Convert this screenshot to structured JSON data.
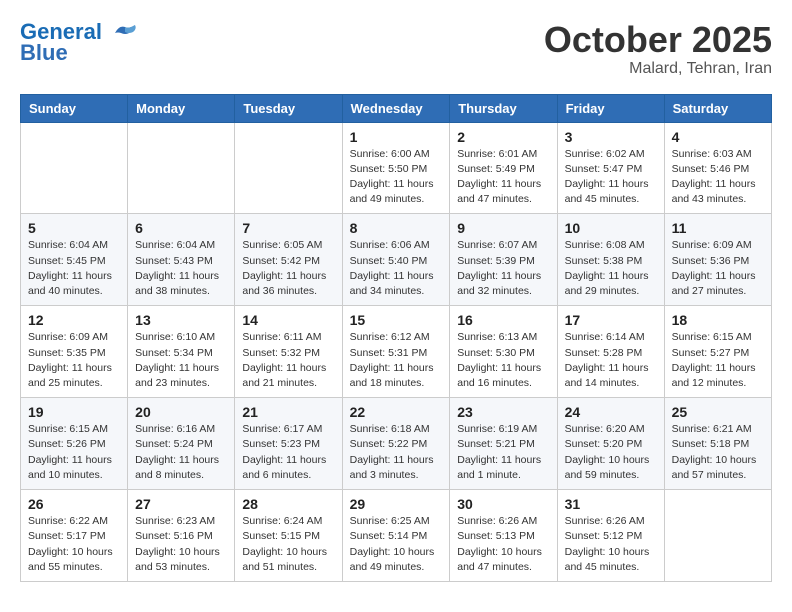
{
  "header": {
    "logo_general": "General",
    "logo_blue": "Blue",
    "month": "October 2025",
    "location": "Malard, Tehran, Iran"
  },
  "weekdays": [
    "Sunday",
    "Monday",
    "Tuesday",
    "Wednesday",
    "Thursday",
    "Friday",
    "Saturday"
  ],
  "weeks": [
    [
      {
        "day": "",
        "info": ""
      },
      {
        "day": "",
        "info": ""
      },
      {
        "day": "",
        "info": ""
      },
      {
        "day": "1",
        "info": "Sunrise: 6:00 AM\nSunset: 5:50 PM\nDaylight: 11 hours\nand 49 minutes."
      },
      {
        "day": "2",
        "info": "Sunrise: 6:01 AM\nSunset: 5:49 PM\nDaylight: 11 hours\nand 47 minutes."
      },
      {
        "day": "3",
        "info": "Sunrise: 6:02 AM\nSunset: 5:47 PM\nDaylight: 11 hours\nand 45 minutes."
      },
      {
        "day": "4",
        "info": "Sunrise: 6:03 AM\nSunset: 5:46 PM\nDaylight: 11 hours\nand 43 minutes."
      }
    ],
    [
      {
        "day": "5",
        "info": "Sunrise: 6:04 AM\nSunset: 5:45 PM\nDaylight: 11 hours\nand 40 minutes."
      },
      {
        "day": "6",
        "info": "Sunrise: 6:04 AM\nSunset: 5:43 PM\nDaylight: 11 hours\nand 38 minutes."
      },
      {
        "day": "7",
        "info": "Sunrise: 6:05 AM\nSunset: 5:42 PM\nDaylight: 11 hours\nand 36 minutes."
      },
      {
        "day": "8",
        "info": "Sunrise: 6:06 AM\nSunset: 5:40 PM\nDaylight: 11 hours\nand 34 minutes."
      },
      {
        "day": "9",
        "info": "Sunrise: 6:07 AM\nSunset: 5:39 PM\nDaylight: 11 hours\nand 32 minutes."
      },
      {
        "day": "10",
        "info": "Sunrise: 6:08 AM\nSunset: 5:38 PM\nDaylight: 11 hours\nand 29 minutes."
      },
      {
        "day": "11",
        "info": "Sunrise: 6:09 AM\nSunset: 5:36 PM\nDaylight: 11 hours\nand 27 minutes."
      }
    ],
    [
      {
        "day": "12",
        "info": "Sunrise: 6:09 AM\nSunset: 5:35 PM\nDaylight: 11 hours\nand 25 minutes."
      },
      {
        "day": "13",
        "info": "Sunrise: 6:10 AM\nSunset: 5:34 PM\nDaylight: 11 hours\nand 23 minutes."
      },
      {
        "day": "14",
        "info": "Sunrise: 6:11 AM\nSunset: 5:32 PM\nDaylight: 11 hours\nand 21 minutes."
      },
      {
        "day": "15",
        "info": "Sunrise: 6:12 AM\nSunset: 5:31 PM\nDaylight: 11 hours\nand 18 minutes."
      },
      {
        "day": "16",
        "info": "Sunrise: 6:13 AM\nSunset: 5:30 PM\nDaylight: 11 hours\nand 16 minutes."
      },
      {
        "day": "17",
        "info": "Sunrise: 6:14 AM\nSunset: 5:28 PM\nDaylight: 11 hours\nand 14 minutes."
      },
      {
        "day": "18",
        "info": "Sunrise: 6:15 AM\nSunset: 5:27 PM\nDaylight: 11 hours\nand 12 minutes."
      }
    ],
    [
      {
        "day": "19",
        "info": "Sunrise: 6:15 AM\nSunset: 5:26 PM\nDaylight: 11 hours\nand 10 minutes."
      },
      {
        "day": "20",
        "info": "Sunrise: 6:16 AM\nSunset: 5:24 PM\nDaylight: 11 hours\nand 8 minutes."
      },
      {
        "day": "21",
        "info": "Sunrise: 6:17 AM\nSunset: 5:23 PM\nDaylight: 11 hours\nand 6 minutes."
      },
      {
        "day": "22",
        "info": "Sunrise: 6:18 AM\nSunset: 5:22 PM\nDaylight: 11 hours\nand 3 minutes."
      },
      {
        "day": "23",
        "info": "Sunrise: 6:19 AM\nSunset: 5:21 PM\nDaylight: 11 hours\nand 1 minute."
      },
      {
        "day": "24",
        "info": "Sunrise: 6:20 AM\nSunset: 5:20 PM\nDaylight: 10 hours\nand 59 minutes."
      },
      {
        "day": "25",
        "info": "Sunrise: 6:21 AM\nSunset: 5:18 PM\nDaylight: 10 hours\nand 57 minutes."
      }
    ],
    [
      {
        "day": "26",
        "info": "Sunrise: 6:22 AM\nSunset: 5:17 PM\nDaylight: 10 hours\nand 55 minutes."
      },
      {
        "day": "27",
        "info": "Sunrise: 6:23 AM\nSunset: 5:16 PM\nDaylight: 10 hours\nand 53 minutes."
      },
      {
        "day": "28",
        "info": "Sunrise: 6:24 AM\nSunset: 5:15 PM\nDaylight: 10 hours\nand 51 minutes."
      },
      {
        "day": "29",
        "info": "Sunrise: 6:25 AM\nSunset: 5:14 PM\nDaylight: 10 hours\nand 49 minutes."
      },
      {
        "day": "30",
        "info": "Sunrise: 6:26 AM\nSunset: 5:13 PM\nDaylight: 10 hours\nand 47 minutes."
      },
      {
        "day": "31",
        "info": "Sunrise: 6:26 AM\nSunset: 5:12 PM\nDaylight: 10 hours\nand 45 minutes."
      },
      {
        "day": "",
        "info": ""
      }
    ]
  ]
}
